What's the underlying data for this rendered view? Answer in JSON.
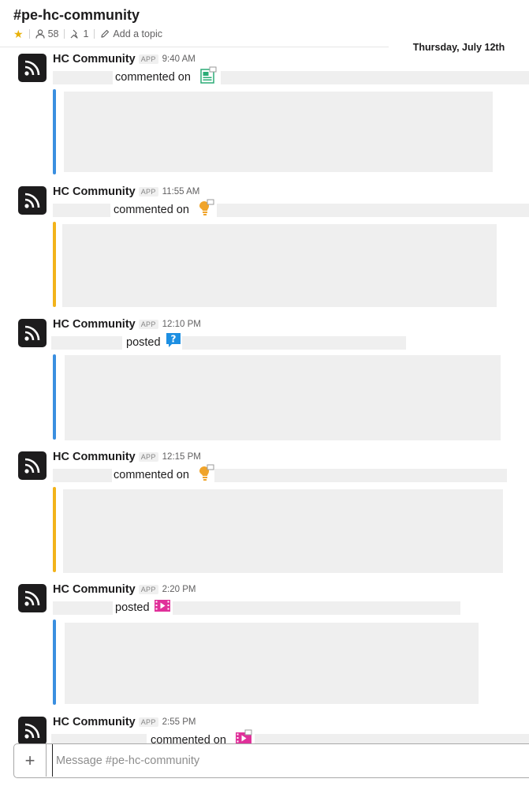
{
  "header": {
    "channel_name": "#pe-hc-community",
    "member_count": "58",
    "pinned_count": "1",
    "add_topic": "Add a topic"
  },
  "date_divider": "Thursday, July 12th",
  "colors": {
    "blue_bar": "#3a8fe0",
    "yellow_bar": "#f2b31a",
    "document_icon": "#2bac76",
    "idea_icon": "#f0a42a",
    "question_icon": "#1d8fe2",
    "video_icon": "#e0309a"
  },
  "messages": [
    {
      "sender": "HC Community",
      "badge": "APP",
      "time": "9:40 AM",
      "action": "commented on",
      "icon": "document-icon"
    },
    {
      "sender": "HC Community",
      "badge": "APP",
      "time": "11:55 AM",
      "action": "commented on",
      "icon": "lightbulb-icon"
    },
    {
      "sender": "HC Community",
      "badge": "APP",
      "time": "12:10 PM",
      "action": "posted",
      "icon": "question-icon"
    },
    {
      "sender": "HC Community",
      "badge": "APP",
      "time": "12:15 PM",
      "action": "commented on",
      "icon": "lightbulb-icon"
    },
    {
      "sender": "HC Community",
      "badge": "APP",
      "time": "2:20 PM",
      "action": "posted",
      "icon": "video-icon"
    },
    {
      "sender": "HC Community",
      "badge": "APP",
      "time": "2:55 PM",
      "action": "commented on",
      "icon": "video-icon"
    }
  ],
  "composer": {
    "plus_label": "+",
    "placeholder": "Message #pe-hc-community"
  }
}
